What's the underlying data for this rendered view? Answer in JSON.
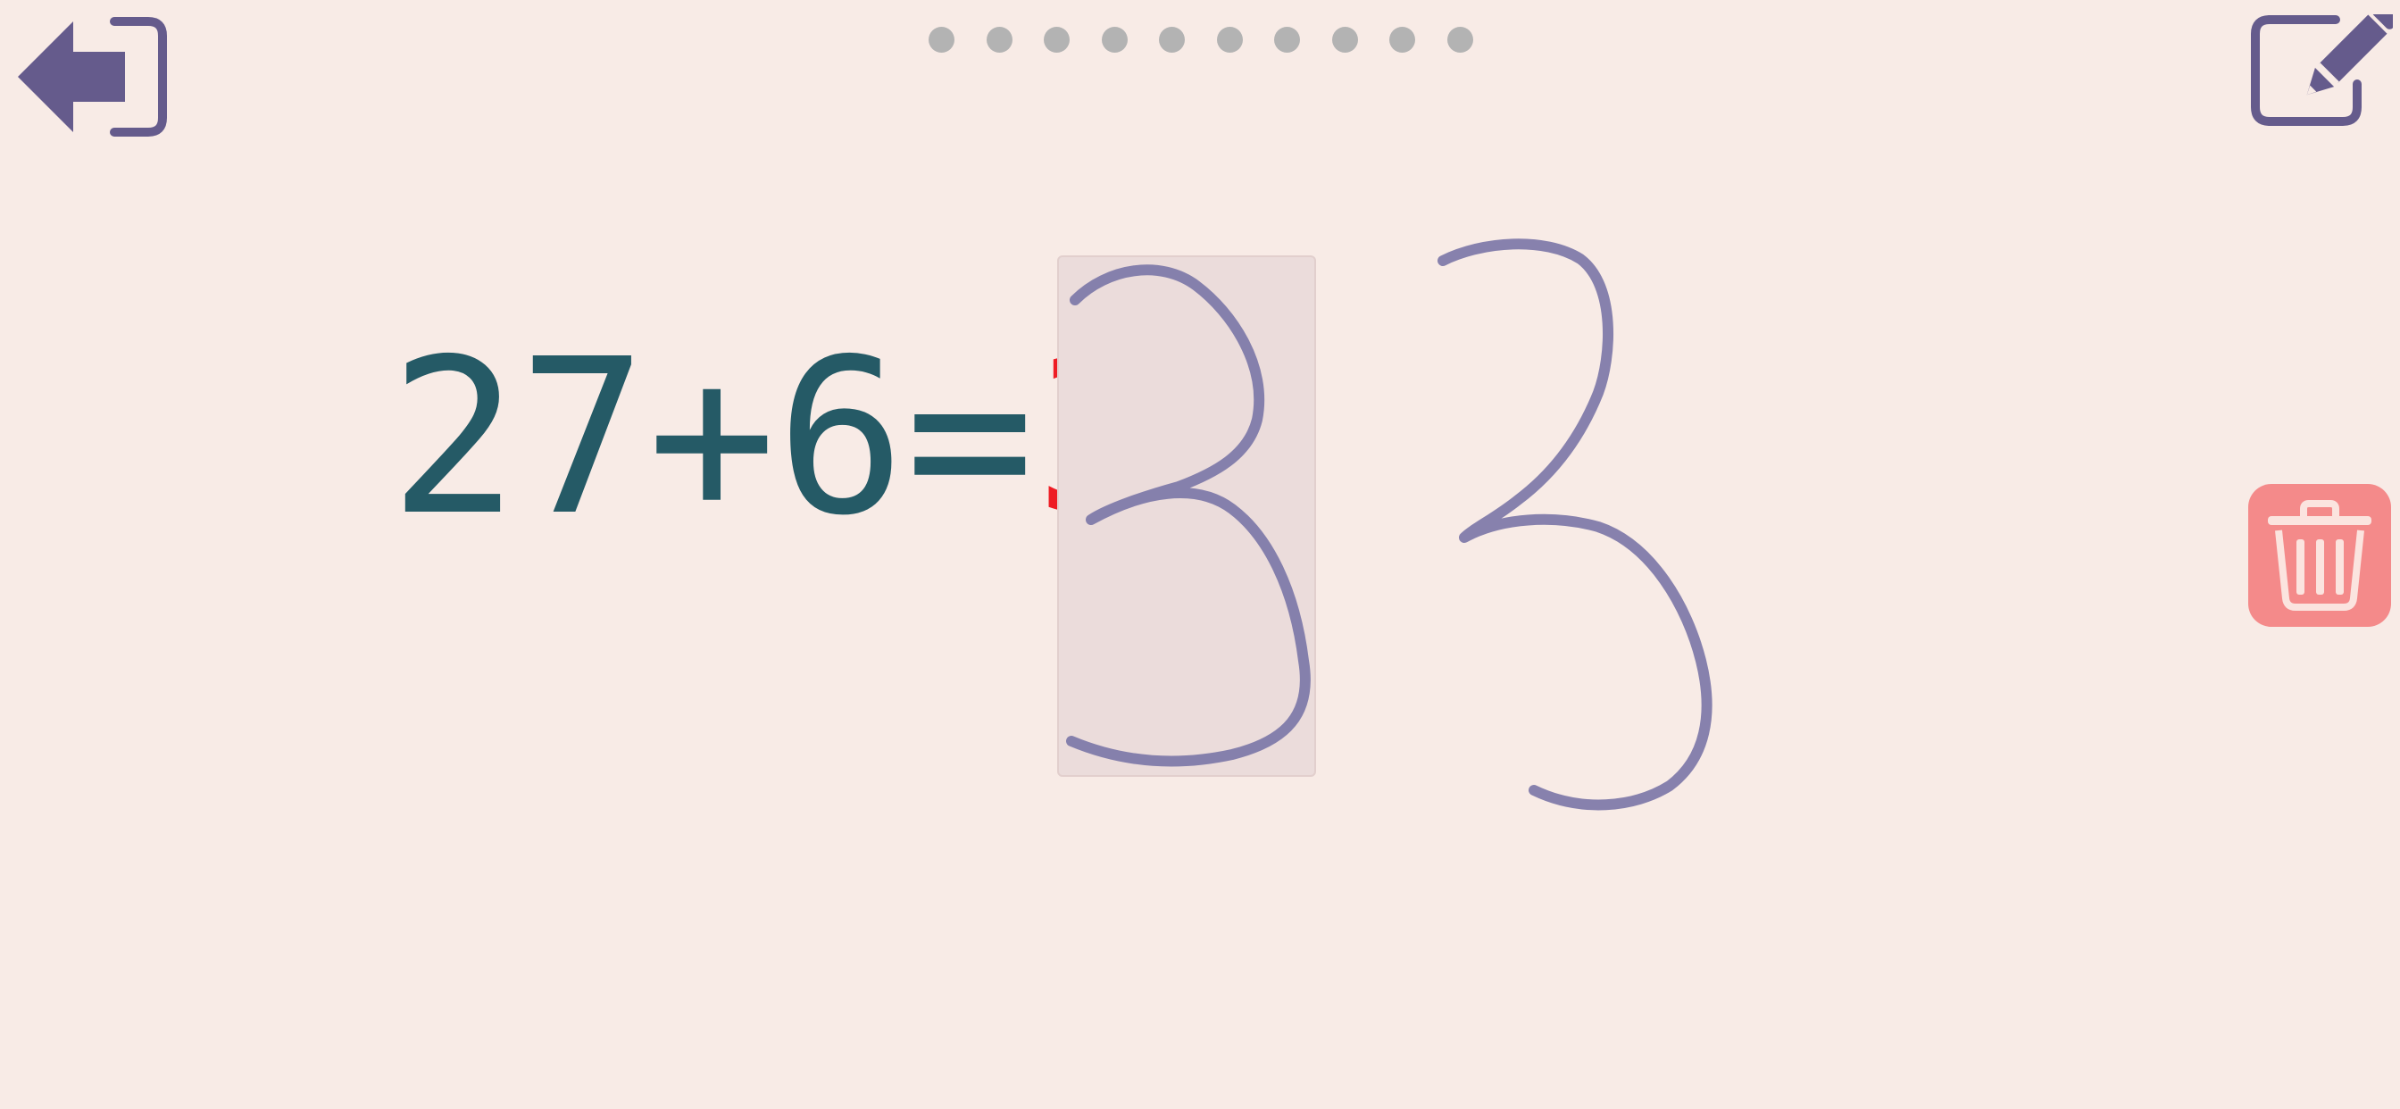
{
  "toolbar": {
    "exit_icon": "exit-arrow-icon",
    "edit_icon": "pencil-edit-icon",
    "clear_icon": "trash-icon",
    "accent_color": "#655b8c",
    "clear_color": "#f48a8a"
  },
  "progress": {
    "total": 10,
    "current": 0,
    "dot_color": "#b3b3b3"
  },
  "equation": {
    "operand1": "27",
    "operator": "+",
    "operand2": "6",
    "equals": "=",
    "answer_entered": "3",
    "text_color": "#255a66",
    "answer_color": "#ee1c24"
  },
  "handwriting": {
    "strokes": [
      "3",
      "3"
    ],
    "ink_color": "#7a76a6"
  }
}
